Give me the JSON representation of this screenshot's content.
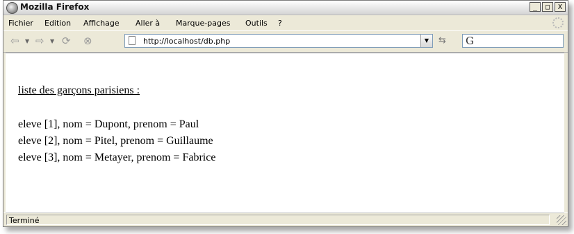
{
  "window": {
    "title": "Mozilla Firefox"
  },
  "window_buttons": {
    "minimize": "_",
    "maximize": "□",
    "close": "X"
  },
  "menubar": {
    "items": [
      {
        "label": "Fichier"
      },
      {
        "label": "Edition"
      },
      {
        "label": "Affichage"
      },
      {
        "label": "Aller à"
      },
      {
        "label": "Marque-pages"
      },
      {
        "label": "Outils"
      },
      {
        "label": "?"
      }
    ]
  },
  "navbar": {
    "url": "http://localhost/db.php",
    "search_engine": "G"
  },
  "page": {
    "heading": "liste des garçons parisiens :",
    "lines": [
      "eleve [1], nom = Dupont, prenom = Paul",
      "eleve [2], nom = Pitel, prenom = Guillaume",
      "eleve [3], nom = Metayer, prenom = Fabrice"
    ]
  },
  "status": {
    "text": "Terminé"
  },
  "icons": {
    "app": "firefox-icon",
    "back": "back-arrow-icon",
    "forward": "forward-arrow-icon",
    "reload": "reload-icon",
    "stop": "stop-icon",
    "page": "page-icon",
    "go": "go-icon",
    "throbber": "throbber-icon"
  }
}
